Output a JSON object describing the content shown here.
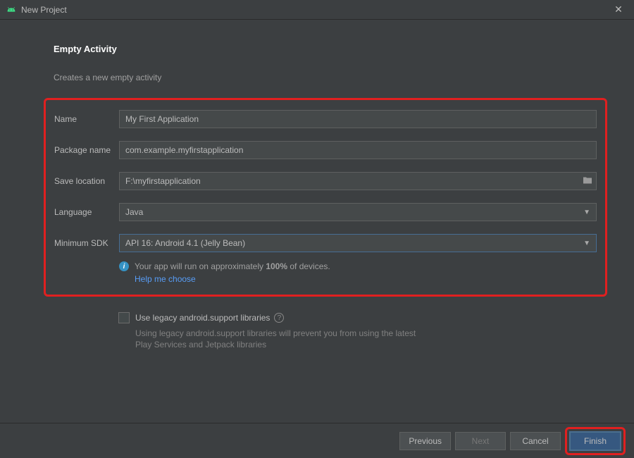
{
  "window": {
    "title": "New Project"
  },
  "heading": "Empty Activity",
  "subtitle": "Creates a new empty activity",
  "fields": {
    "name": {
      "label": "Name",
      "value": "My First Application"
    },
    "package": {
      "label": "Package name",
      "value": "com.example.myfirstapplication"
    },
    "save": {
      "label": "Save location",
      "value": "F:\\myfirstapplication"
    },
    "language": {
      "label": "Language",
      "value": "Java"
    },
    "sdk": {
      "label": "Minimum SDK",
      "value": "API 16: Android 4.1 (Jelly Bean)"
    }
  },
  "info": {
    "prefix": "Your app will run on approximately ",
    "percent": "100%",
    "suffix": " of devices.",
    "help_link": "Help me choose"
  },
  "legacy": {
    "label": "Use legacy android.support libraries",
    "hint": "Using legacy android.support libraries will prevent you from using the latest Play Services and Jetpack libraries"
  },
  "buttons": {
    "previous": "Previous",
    "next": "Next",
    "cancel": "Cancel",
    "finish": "Finish"
  }
}
